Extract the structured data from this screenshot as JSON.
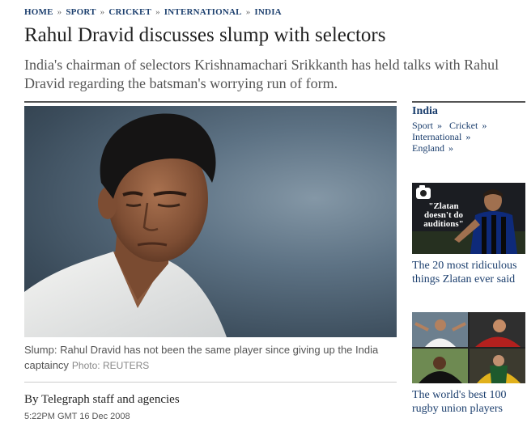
{
  "breadcrumb": [
    {
      "label": "HOME"
    },
    {
      "label": "SPORT"
    },
    {
      "label": "CRICKET"
    },
    {
      "label": "INTERNATIONAL"
    },
    {
      "label": "INDIA"
    }
  ],
  "breadcrumb_separator": "»",
  "headline": "Rahul Dravid discusses slump with selectors",
  "standfirst": "India's chairman of selectors Krishnamachari Srikkanth has held talks with Rahul Dravid regarding the batsman's worrying run of form.",
  "photo": {
    "caption": "Slump: Rahul Dravid has not been the same player since giving up the India captaincy",
    "credit": "Photo: REUTERS"
  },
  "byline": "By Telegraph staff and agencies",
  "dateline": "5:22PM GMT 16 Dec 2008",
  "sidebar": {
    "title": "India",
    "links": [
      {
        "label": "Sport"
      },
      {
        "label": "Cricket"
      },
      {
        "label": "International"
      },
      {
        "label": "England"
      }
    ],
    "link_marker": "»",
    "promo1": {
      "quote": "\"Zlatan doesn't do auditions\"",
      "headline": "The 20 most ridiculous things Zlatan ever said",
      "icon": "camera-icon"
    },
    "promo2": {
      "headline": "The world's best 100 rugby union players"
    }
  },
  "colors": {
    "link": "#1c3f6e",
    "text": "#333333",
    "caption": "#555555"
  }
}
